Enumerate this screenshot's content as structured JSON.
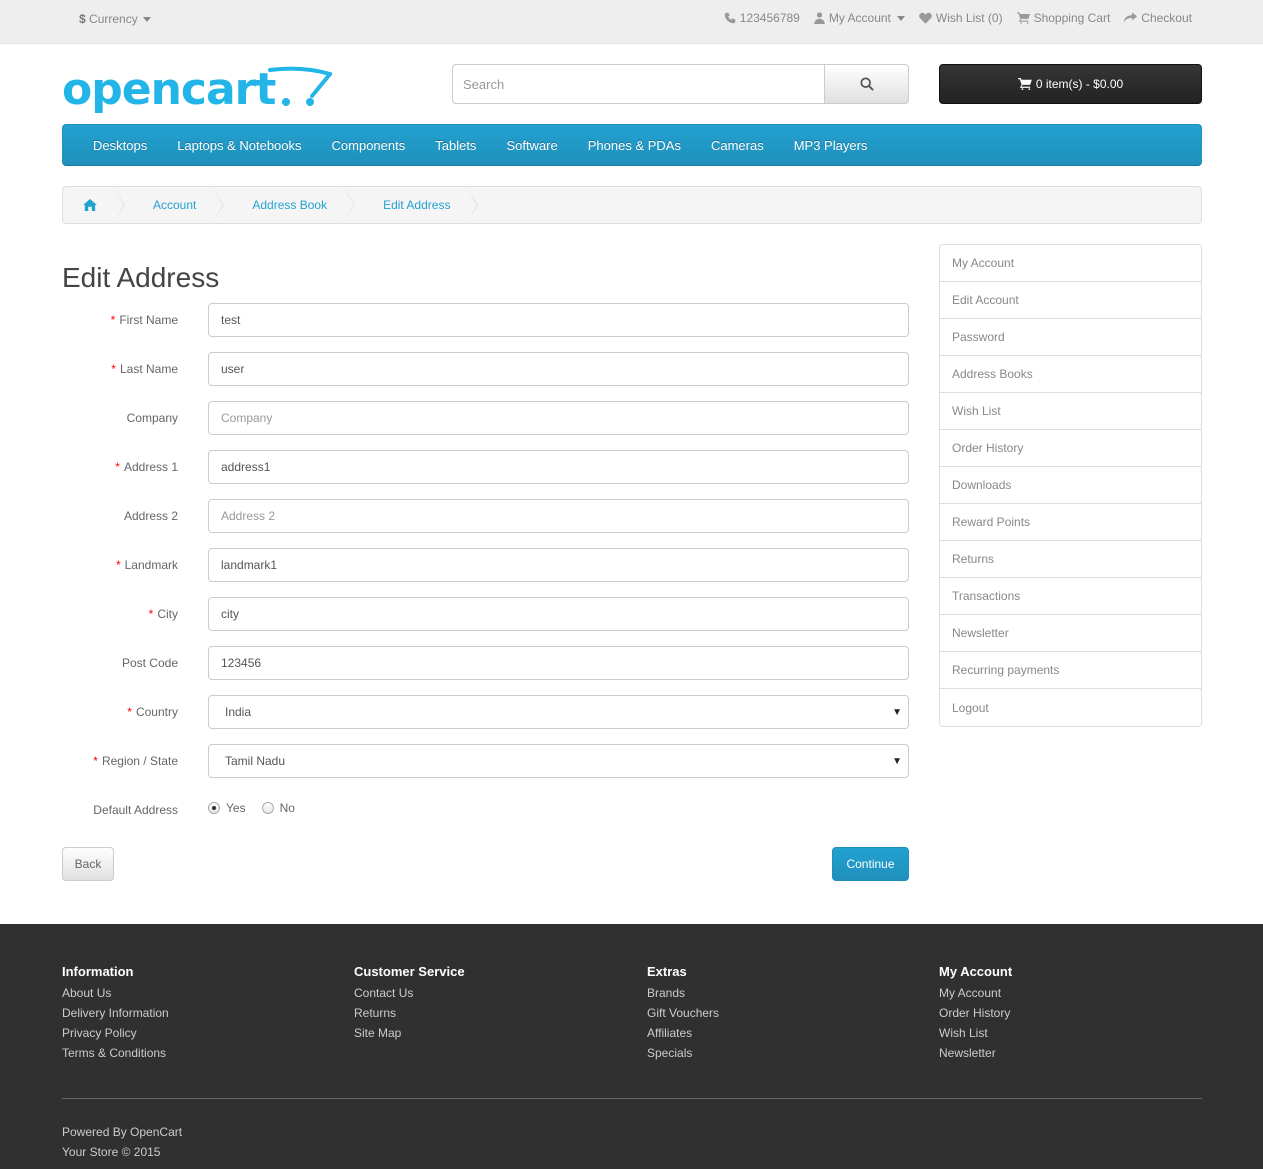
{
  "topbar": {
    "currency_symbol": "$",
    "currency_label": "Currency",
    "phone": "123456789",
    "my_account": "My Account",
    "wish_list": "Wish List (0)",
    "shopping_cart": "Shopping Cart",
    "checkout": "Checkout"
  },
  "header": {
    "logo_text": "opencart",
    "search_placeholder": "Search",
    "cart_label": "0 item(s) - $0.00"
  },
  "menu": [
    "Desktops",
    "Laptops & Notebooks",
    "Components",
    "Tablets",
    "Software",
    "Phones & PDAs",
    "Cameras",
    "MP3 Players"
  ],
  "breadcrumb": [
    "Account",
    "Address Book",
    "Edit Address"
  ],
  "page_title": "Edit Address",
  "form": {
    "first_name": {
      "label": "First Name",
      "value": "test",
      "placeholder": "First Name"
    },
    "last_name": {
      "label": "Last Name",
      "value": "user",
      "placeholder": "Last Name"
    },
    "company": {
      "label": "Company",
      "value": "",
      "placeholder": "Company"
    },
    "address_1": {
      "label": "Address 1",
      "value": "address1",
      "placeholder": "Address 1"
    },
    "address_2": {
      "label": "Address 2",
      "value": "",
      "placeholder": "Address 2"
    },
    "landmark": {
      "label": "Landmark",
      "value": "landmark1",
      "placeholder": "Landmark"
    },
    "city": {
      "label": "City",
      "value": "city",
      "placeholder": "City"
    },
    "postcode": {
      "label": "Post Code",
      "value": "123456",
      "placeholder": "Post Code"
    },
    "country": {
      "label": "Country",
      "value": "India"
    },
    "region": {
      "label": "Region / State",
      "value": "Tamil Nadu"
    },
    "default_address": {
      "label": "Default Address",
      "yes": "Yes",
      "no": "No",
      "selected": "Yes"
    }
  },
  "buttons": {
    "back": "Back",
    "continue": "Continue"
  },
  "sidebar": [
    "My Account",
    "Edit Account",
    "Password",
    "Address Books",
    "Wish List",
    "Order History",
    "Downloads",
    "Reward Points",
    "Returns",
    "Transactions",
    "Newsletter",
    "Recurring payments",
    "Logout"
  ],
  "footer": {
    "columns": [
      {
        "title": "Information",
        "links": [
          "About Us",
          "Delivery Information",
          "Privacy Policy",
          "Terms & Conditions"
        ]
      },
      {
        "title": "Customer Service",
        "links": [
          "Contact Us",
          "Returns",
          "Site Map"
        ]
      },
      {
        "title": "Extras",
        "links": [
          "Brands",
          "Gift Vouchers",
          "Affiliates",
          "Specials"
        ]
      },
      {
        "title": "My Account",
        "links": [
          "My Account",
          "Order History",
          "Wish List",
          "Newsletter"
        ]
      }
    ],
    "powered_prefix": "Powered By",
    "powered_link": "OpenCart",
    "copyright": "Your Store © 2015"
  },
  "colors": {
    "accent": "#23a1d1",
    "required": "#ff0000",
    "footer_bg": "#303030"
  }
}
